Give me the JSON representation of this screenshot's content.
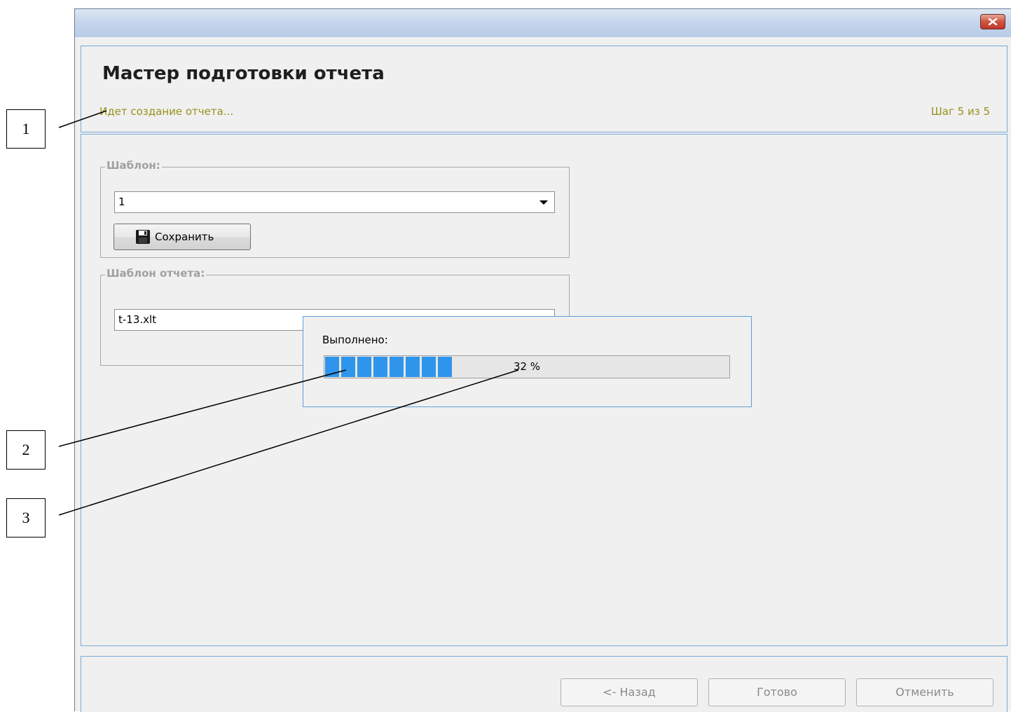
{
  "callouts": [
    "1",
    "2",
    "3"
  ],
  "wizard": {
    "title": "Мастер подготовки отчета",
    "status": "Идет создание отчета...",
    "step": "Шаг 5 из 5"
  },
  "template_group": {
    "legend": "Шаблон:",
    "selected_value": "1",
    "save_label": "Сохранить"
  },
  "report_template_group": {
    "legend": "Шаблон отчета:",
    "value": "t-13.xlt"
  },
  "progress": {
    "label": "Выполнено:",
    "percent": 32,
    "percent_text": "32 %"
  },
  "footer": {
    "back_label": "<- Назад",
    "done_label": "Готово",
    "cancel_label": "Отменить"
  },
  "icons": {
    "close": "close-icon",
    "save": "floppy-disk-icon",
    "dropdown": "chevron-down-icon"
  },
  "colors": {
    "accent_border": "#7aa8d6",
    "status_text": "#9a8f1c",
    "progress_fill": "#2f95ec",
    "close_button": "#c0392b"
  }
}
